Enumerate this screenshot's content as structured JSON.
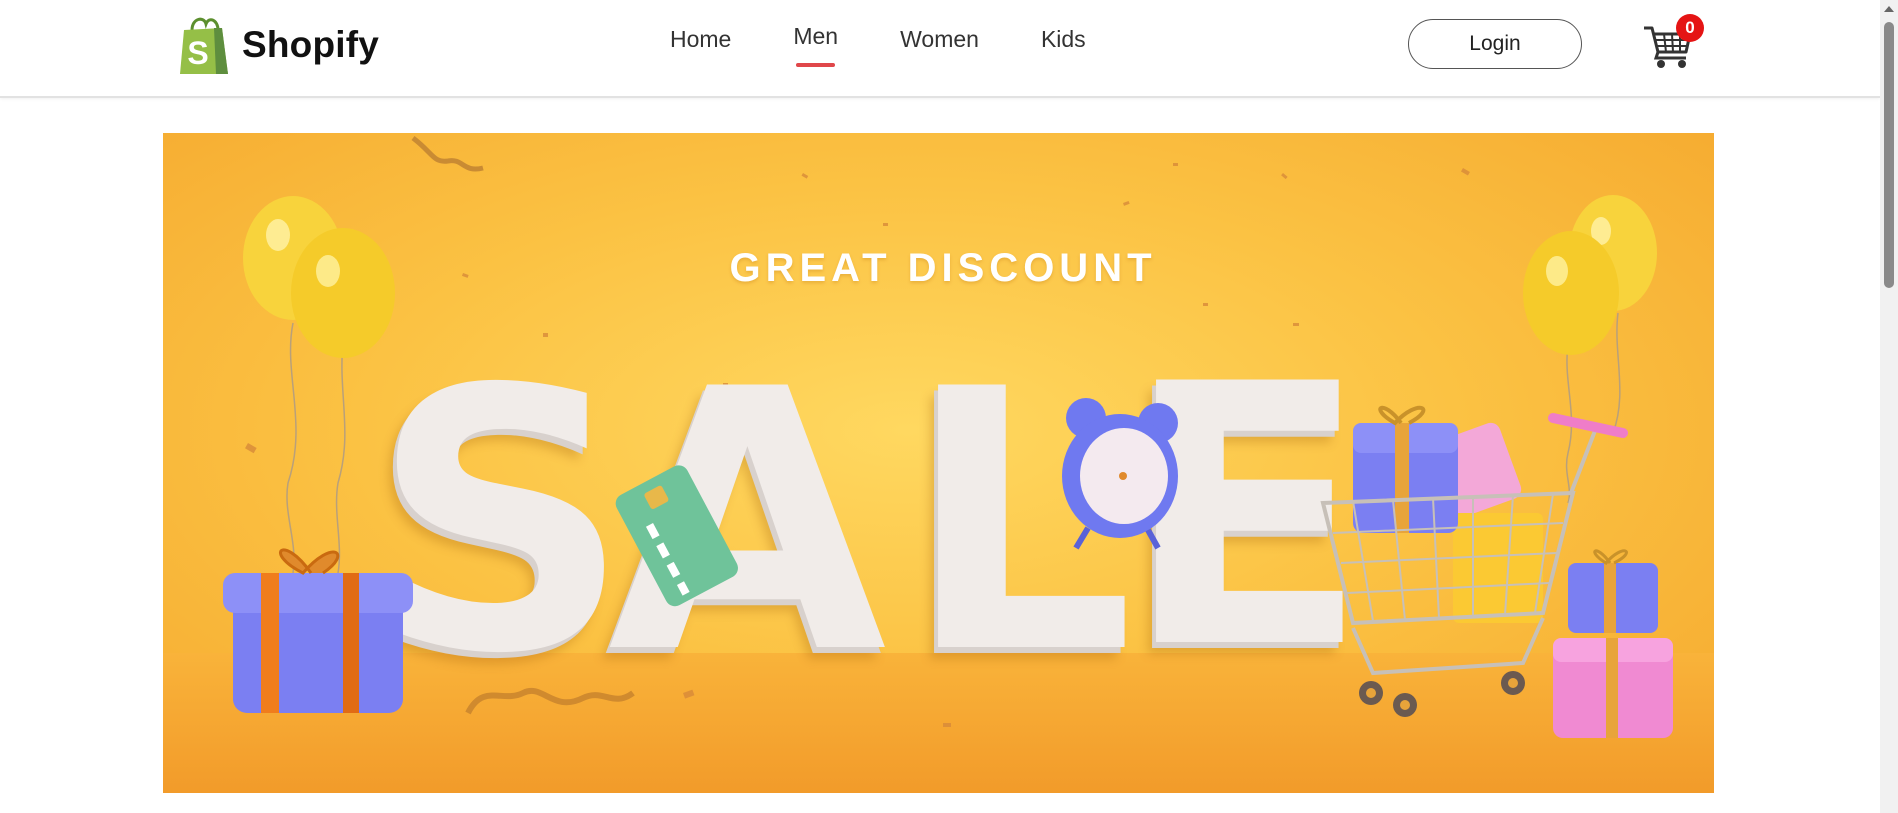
{
  "header": {
    "brand": "Shopify",
    "nav": [
      {
        "label": "Home",
        "active": false
      },
      {
        "label": "Men",
        "active": true
      },
      {
        "label": "Women",
        "active": false
      },
      {
        "label": "Kids",
        "active": false
      }
    ],
    "login_label": "Login",
    "cart_count": "0"
  },
  "banner": {
    "heading": "GREAT DISCOUNT",
    "sale_letters": [
      "S",
      "A",
      "L",
      "E"
    ]
  },
  "icons": [
    "shopify-bag-icon",
    "cart-icon",
    "balloon-icon",
    "gift-box-icon",
    "credit-card-icon",
    "alarm-clock-icon",
    "shopping-cart-icon"
  ],
  "colors": {
    "accent_underline": "#e0474a",
    "badge": "#e51414",
    "banner_yellow": "#fbc243",
    "letter_white": "#f1ece9",
    "gift_purple": "#7b7ff2",
    "gift_pink": "#f08ad2",
    "ribbon_orange": "#f07d1c"
  }
}
